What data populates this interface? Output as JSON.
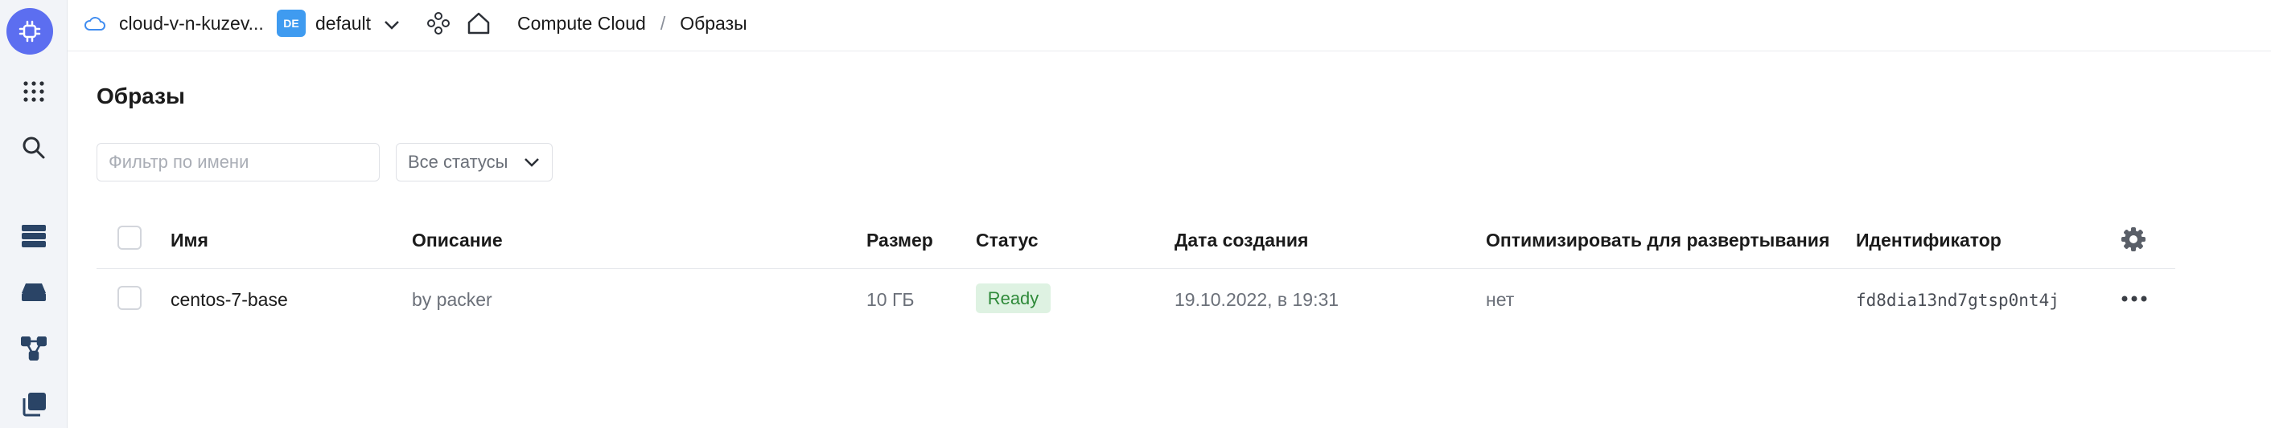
{
  "header": {
    "cloud_name": "cloud-v-n-kuzev...",
    "folder_badge": "DE",
    "folder_name": "default",
    "breadcrumb_service": "Compute Cloud",
    "breadcrumb_sep": "/",
    "breadcrumb_current": "Образы"
  },
  "page": {
    "title": "Образы"
  },
  "filters": {
    "name_placeholder": "Фильтр по имени",
    "status_value": "Все статусы"
  },
  "table": {
    "columns": [
      "Имя",
      "Описание",
      "Размер",
      "Статус",
      "Дата создания",
      "Оптимизировать для развертывания",
      "Идентификатор"
    ],
    "rows": [
      {
        "name": "centos-7-base",
        "description": "by packer",
        "size": "10 ГБ",
        "status": "Ready",
        "created": "19.10.2022, в 19:31",
        "optimize": "нет",
        "id": "fd8dia13nd7gtsp0nt4j"
      }
    ]
  },
  "colors": {
    "accent": "#5c6ef0",
    "folder_badge": "#3f9bf0",
    "ready_bg": "#def2e2",
    "ready_text": "#2f8a3a"
  },
  "icons": {
    "rail": [
      "compute-logo-icon",
      "apps-grid-icon",
      "search-icon",
      "servers-icon",
      "disk-icon",
      "network-icon",
      "images-stack-icon"
    ],
    "header": [
      "cloud-icon",
      "chevron-down-icon",
      "services-icon",
      "home-icon"
    ]
  }
}
